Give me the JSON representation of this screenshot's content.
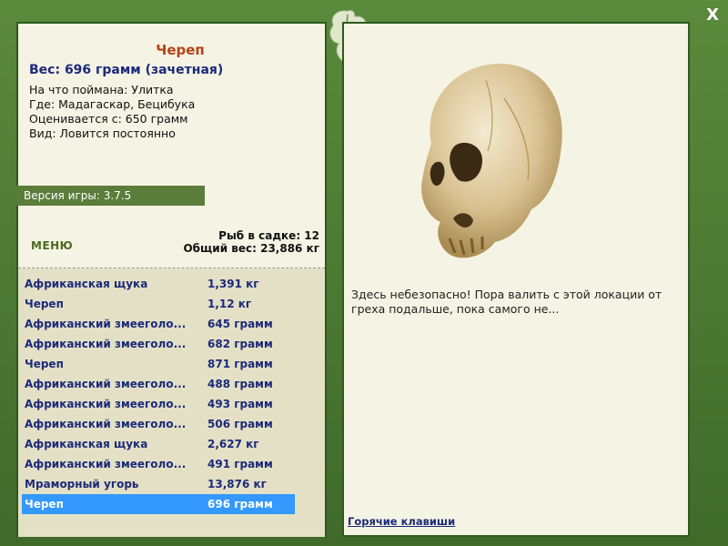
{
  "fish": {
    "title": "Череп",
    "weight_line": "Вес: 696 грамм (зачетная)",
    "caught_on": "На что поймана: Улитка",
    "where": "Где: Мадагаскар, Бецибука",
    "valued_from": "Оценивается с: 650 грамм",
    "type": "Вид: Ловится постоянно"
  },
  "version": "Версия игры: 3.7.5",
  "menu_label": "МЕНЮ",
  "stats": {
    "fish_in_tank": "Рыб в садке: 12",
    "total_weight": "Общий вес: 23,886 кг"
  },
  "catch_list": [
    {
      "name": "Африканская щука",
      "weight": "1,391 кг"
    },
    {
      "name": "Череп",
      "weight": "1,12 кг"
    },
    {
      "name": "Африканский змееголо...",
      "weight": "645 грамм"
    },
    {
      "name": "Африканский змееголо...",
      "weight": "682 грамм"
    },
    {
      "name": "Череп",
      "weight": "871 грамм"
    },
    {
      "name": "Африканский змееголо...",
      "weight": "488 грамм"
    },
    {
      "name": "Африканский змееголо...",
      "weight": "493 грамм"
    },
    {
      "name": "Африканский змееголо...",
      "weight": "506 грамм"
    },
    {
      "name": "Африканская щука",
      "weight": "2,627 кг"
    },
    {
      "name": "Африканский змееголо...",
      "weight": "491 грамм"
    },
    {
      "name": "Мраморный угорь",
      "weight": "13,876 кг"
    },
    {
      "name": "Череп",
      "weight": "696 грамм"
    }
  ],
  "message": "Здесь небезопасно! Пора валить с этой локации от греха подальше, пока самого не...",
  "hotkeys_label": "Горячие клавиши",
  "close_label": "X",
  "colors": {
    "frame": "#4f7a36",
    "panel": "#f5f3e4",
    "list_bg": "#e4e0c6",
    "selection": "#3399ff",
    "title": "#b34418",
    "text_blue": "#1c2a7a"
  }
}
